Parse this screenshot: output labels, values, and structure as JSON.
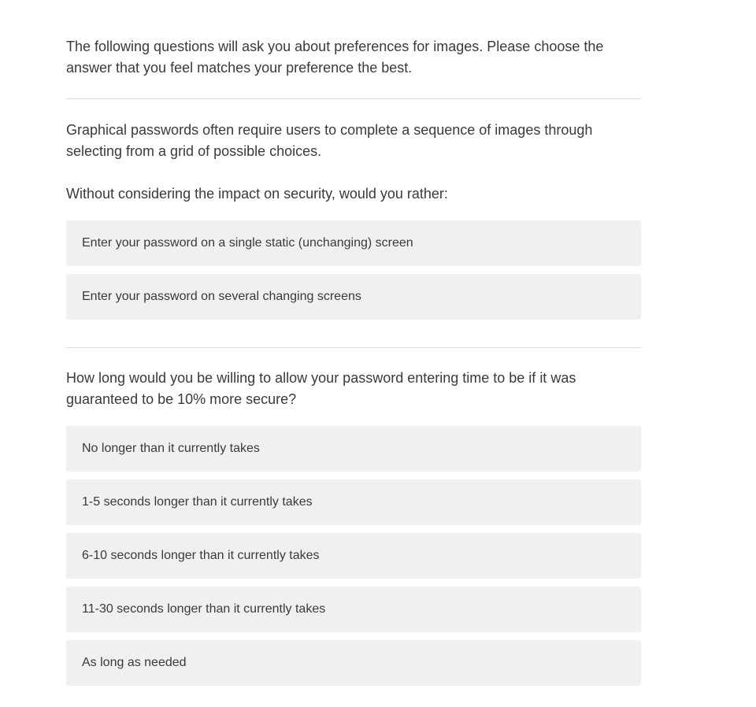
{
  "intro": {
    "text": "The following questions will ask you about preferences for images. Please choose the answer that you feel matches your preference the best."
  },
  "question1": {
    "text": "Graphical passwords often require users to complete a sequence of images through selecting from a grid of possible choices.",
    "sub": "Without considering the impact on security, would you rather:",
    "choices": [
      "Enter your password on a single static (unchanging) screen",
      "Enter your password on several changing screens"
    ]
  },
  "question2": {
    "text": "How long would you be willing to allow your password entering time to be if it was guaranteed to be 10% more secure?",
    "choices": [
      "No longer than it currently takes",
      "1-5 seconds longer than it currently takes",
      "6-10 seconds longer than it currently takes",
      "11-30 seconds longer than it currently takes",
      "As long as needed"
    ]
  }
}
